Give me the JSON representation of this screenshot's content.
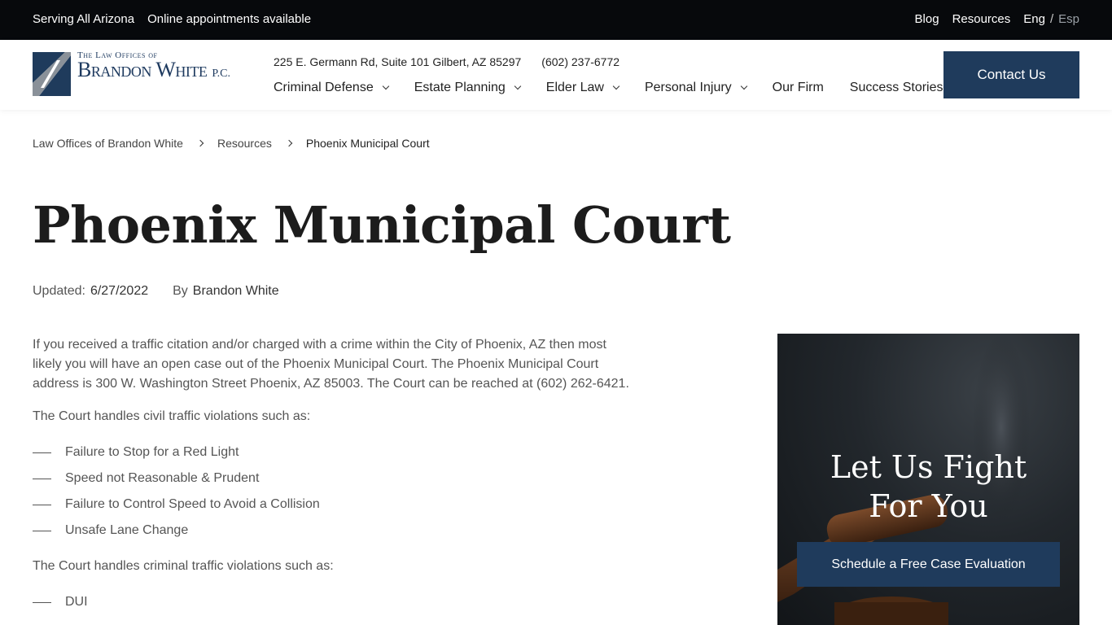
{
  "topbar": {
    "serving": "Serving All Arizona",
    "online": "Online appointments available",
    "blog": "Blog",
    "resources": "Resources",
    "lang_en": "Eng",
    "lang_sep": "/",
    "lang_es": "Esp"
  },
  "logo": {
    "small": "The Law Offices of",
    "big": "Brandon White",
    "pc": "P.C."
  },
  "header": {
    "address": "225 E. Germann Rd, Suite 101 Gilbert, AZ 85297",
    "phone": "(602) 237-6772",
    "contact_label": "Contact Us"
  },
  "nav": [
    {
      "label": "Criminal Defense",
      "icon": "chevron-down-icon"
    },
    {
      "label": "Estate Planning",
      "icon": "chevron-down-icon"
    },
    {
      "label": "Elder Law",
      "icon": "chevron-down-icon"
    },
    {
      "label": "Personal Injury",
      "icon": "chevron-down-icon"
    },
    {
      "label": "Our Firm"
    },
    {
      "label": "Success Stories"
    }
  ],
  "breadcrumb": {
    "home": "Law Offices of Brandon White",
    "section": "Resources",
    "current": "Phoenix Municipal Court"
  },
  "page": {
    "title": "Phoenix Municipal Court",
    "updated_label": "Updated:",
    "updated_date": "6/27/2022",
    "by_label": "By",
    "author": "Brandon White",
    "intro": "If you received a traffic citation and/or charged with a crime within the City of Phoenix, AZ then most likely you will have an open case out of the Phoenix Municipal Court. The Phoenix Municipal Court address is 300 W. Washington Street Phoenix, AZ 85003. The Court can be reached at (602) 262-6421.",
    "civil_heading": "The Court handles civil traffic violations such as:",
    "civil_items": [
      "Failure to Stop for a Red Light",
      "Speed not Reasonable & Prudent",
      "Failure to Control Speed to Avoid a Collision",
      "Unsafe Lane Change"
    ],
    "criminal_heading": "The Court handles criminal traffic violations such as:",
    "criminal_items": [
      "DUI"
    ]
  },
  "cta": {
    "title_line1": "Let Us Fight",
    "title_line2": "For You",
    "button": "Schedule a Free Case Evaluation"
  },
  "colors": {
    "brand_navy": "#1f3b5c",
    "topbar_bg": "#07090c"
  }
}
